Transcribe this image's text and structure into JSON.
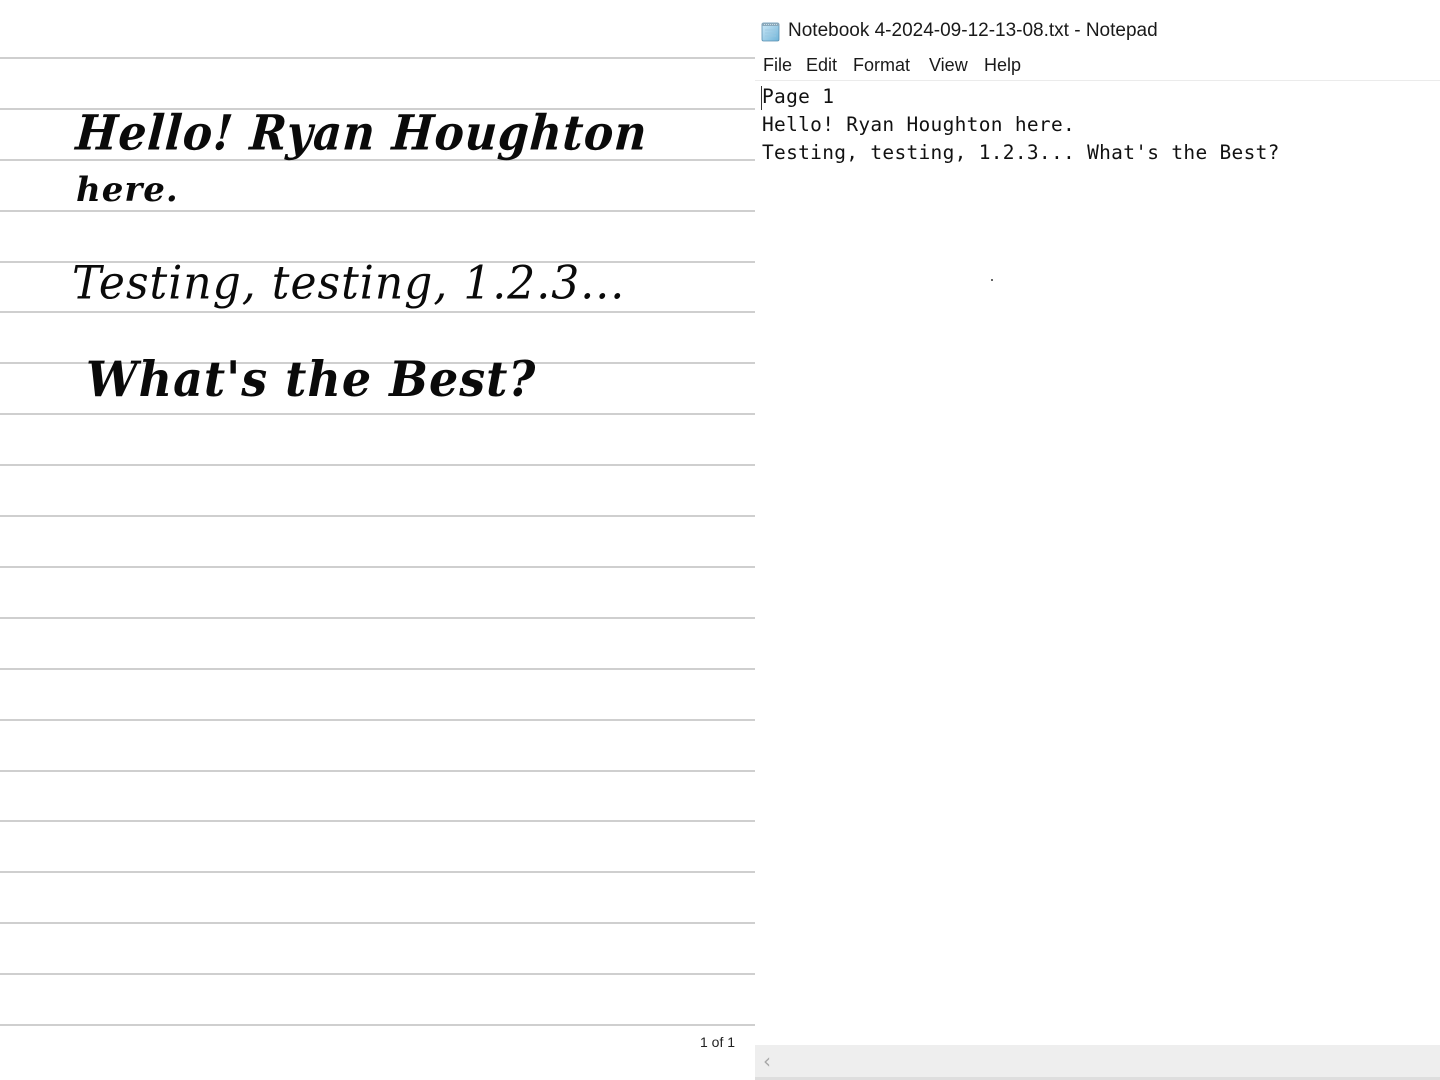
{
  "notebook": {
    "handwriting_lines": [
      "Hello! Ryan Houghton",
      "here.",
      "Testing, testing, 1.2.3...",
      "What's the Best?"
    ],
    "ruled_line_count": 20,
    "page_counter": "1 of 1"
  },
  "notepad": {
    "app_icon": "notepad-icon",
    "title": "Notebook 4-2024-09-12-13-08.txt - Notepad",
    "menu": [
      "File",
      "Edit",
      "Format",
      "View",
      "Help"
    ],
    "content": "Page 1\nHello! Ryan Houghton here.\nTesting, testing, 1.2.3... What's the Best?",
    "scrollbar": {
      "left_arrow_icon": "chevron-left-icon",
      "left_arrow_glyph": "‹"
    }
  },
  "colors": {
    "ruled_line": "#cfcfcf",
    "scrollbar_bg": "#eeeeee",
    "ink": "#0a0a0a"
  }
}
